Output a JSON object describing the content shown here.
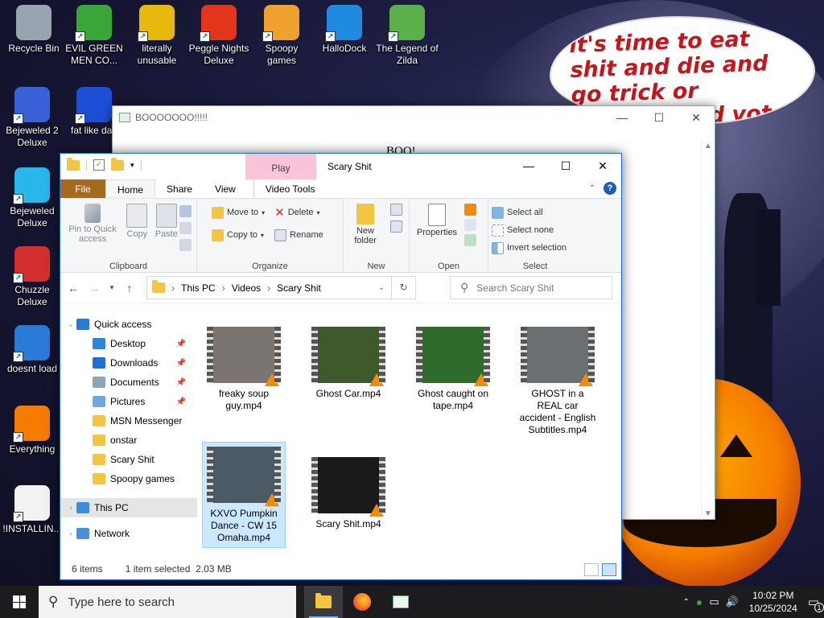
{
  "wallpaper": {
    "banner_text": "it's time to eat shit and die and go trick or treating and vote!"
  },
  "desktop_icons": [
    {
      "label": "Recycle Bin",
      "icon": "recycle-bin-icon",
      "color": "#9aa4b0"
    },
    {
      "label": "EVIL GREEN MEN CO...",
      "icon": "msn-messenger-icon",
      "color": "#3aa63a"
    },
    {
      "label": "literally unusable",
      "icon": "chrome-icon",
      "color": "#e8b90c"
    },
    {
      "label": "Peggle Nights Deluxe",
      "icon": "peggle-icon",
      "color": "#e2351b"
    },
    {
      "label": "Spoopy games",
      "icon": "folder-icon",
      "color": "#f0a030"
    },
    {
      "label": "HalloDock",
      "icon": "windows-flag-icon",
      "color": "#1f8ae0"
    },
    {
      "label": "The Legend of Zilda",
      "icon": "zilda-icon",
      "color": "#5bb04a"
    },
    {
      "label": "Bejeweled 2 Deluxe",
      "icon": "bejeweled2-icon",
      "color": "#3a62d8"
    },
    {
      "label": "fat like darl",
      "icon": "mpl-icon",
      "color": "#1d4ed8"
    },
    {
      "label": "Bejeweled Deluxe",
      "icon": "bejeweled-icon",
      "color": "#29b6e8"
    },
    {
      "label": "Chuzzle Deluxe",
      "icon": "chuzzle-icon",
      "color": "#d32f2f"
    },
    {
      "label": "doesnt load",
      "icon": "thunderbird-icon",
      "color": "#2a7ad8"
    },
    {
      "label": "Everything",
      "icon": "everything-search-icon",
      "color": "#f57c00"
    },
    {
      "label": "!INSTALLIN...",
      "icon": "text-file-icon",
      "color": "#f2f2f2"
    }
  ],
  "boo_window": {
    "title": "BOOOOOOO!!!!!",
    "body": "BOO!"
  },
  "explorer": {
    "title": "Scary Shit",
    "context_tab": "Play",
    "window_controls": {
      "minimize": "—",
      "maximize": "☐",
      "close": "✕"
    },
    "tabs": [
      "File",
      "Home",
      "Share",
      "View",
      "Video Tools"
    ],
    "ribbon": {
      "clipboard": {
        "label": "Clipboard",
        "pin": "Pin to Quick access",
        "copy": "Copy",
        "paste": "Paste"
      },
      "organize": {
        "label": "Organize",
        "move_to": "Move to",
        "copy_to": "Copy to",
        "delete": "Delete",
        "rename": "Rename"
      },
      "new": {
        "label": "New",
        "new_folder": "New folder"
      },
      "open": {
        "label": "Open",
        "properties": "Properties"
      },
      "select": {
        "label": "Select",
        "select_all": "Select all",
        "select_none": "Select none",
        "invert": "Invert selection"
      }
    },
    "breadcrumb": [
      "This PC",
      "Videos",
      "Scary Shit"
    ],
    "search_placeholder": "Search Scary Shit",
    "nav_tree": [
      {
        "label": "Quick access",
        "type": "quick",
        "pinned": false
      },
      {
        "label": "Desktop",
        "type": "desktop",
        "pinned": true
      },
      {
        "label": "Downloads",
        "type": "downloads",
        "pinned": true
      },
      {
        "label": "Documents",
        "type": "documents",
        "pinned": true
      },
      {
        "label": "Pictures",
        "type": "pictures",
        "pinned": true
      },
      {
        "label": "MSN Messenger",
        "type": "folder",
        "pinned": false
      },
      {
        "label": "onstar",
        "type": "folder",
        "pinned": false
      },
      {
        "label": "Scary Shit",
        "type": "folder",
        "pinned": false
      },
      {
        "label": "Spoopy games",
        "type": "folder",
        "pinned": false
      },
      {
        "label": "This PC",
        "type": "pc",
        "pinned": false
      },
      {
        "label": "Network",
        "type": "network",
        "pinned": false
      }
    ],
    "files": [
      {
        "name": "freaky soup guy.mp4",
        "thumb": "#7a7570",
        "selected": false
      },
      {
        "name": "Ghost Car.mp4",
        "thumb": "#3e5a2a",
        "selected": false
      },
      {
        "name": "Ghost caught on tape.mp4",
        "thumb": "#2f6b2a",
        "selected": false
      },
      {
        "name": "GHOST in a REAL car accident - English Subtitles.mp4",
        "thumb": "#6b6f72",
        "selected": false
      },
      {
        "name": "KXVO Pumpkin Dance - CW 15 Omaha.mp4",
        "thumb": "#4c5a66",
        "selected": true
      },
      {
        "name": "Scary Shit.mp4",
        "thumb": "#1a1a1a",
        "selected": false
      }
    ],
    "status": {
      "count": "6 items",
      "selection": "1 item selected  2.03 MB"
    }
  },
  "taskbar": {
    "search_placeholder": "Type here to search",
    "time": "10:02 PM",
    "date": "10/25/2024",
    "notification_count": "1"
  }
}
